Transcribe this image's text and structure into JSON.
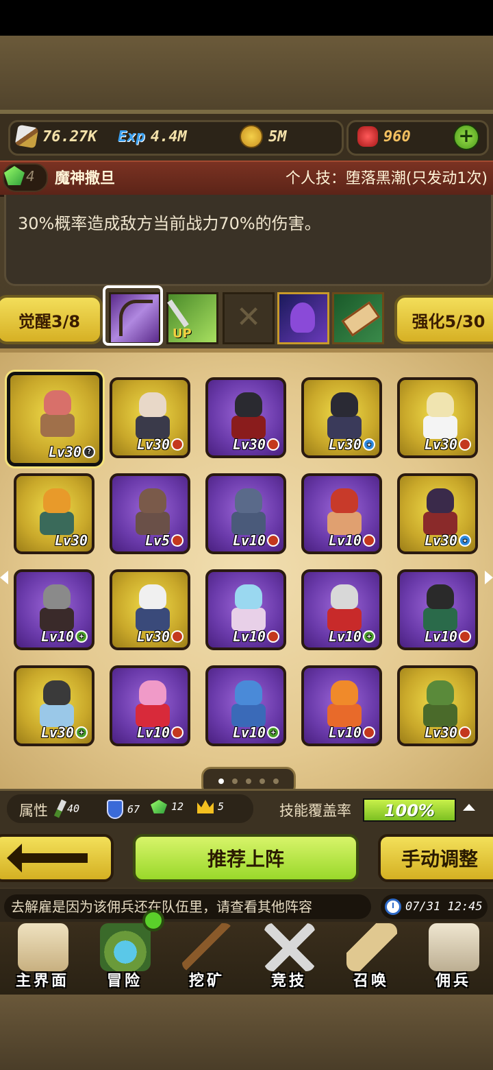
{
  "resources": {
    "attack": "76.27K",
    "exp": "4.4M",
    "gold": "5M",
    "gems": "960"
  },
  "skill": {
    "level": "4",
    "hero_name": "魔神撒旦",
    "personal_skill": "个人技：堕落黑潮(只发动1次)",
    "description": "30%概率造成敌方当前战力70%的伤害。"
  },
  "awaken_label": "觉醒3/8",
  "enhance_label": "强化5/30",
  "heroes": [
    {
      "lv": "Lv30",
      "tier": "gold",
      "badge": "help",
      "badge_glyph": "?",
      "head": "#d8706a",
      "body": "#a0704a"
    },
    {
      "lv": "Lv30",
      "tier": "gold",
      "badge": "red",
      "badge_glyph": "",
      "head": "#e8d8c8",
      "body": "#3a3a4a"
    },
    {
      "lv": "Lv30",
      "tier": "purple",
      "badge": "red",
      "badge_glyph": "",
      "head": "#2a2a30",
      "body": "#8a1c1c"
    },
    {
      "lv": "Lv30",
      "tier": "gold",
      "badge": "blue",
      "badge_glyph": "★",
      "head": "#2a2a34",
      "body": "#3a3a5a"
    },
    {
      "lv": "Lv30",
      "tier": "gold",
      "badge": "red",
      "badge_glyph": "",
      "head": "#f0e4b0",
      "body": "#f4f4f4"
    },
    {
      "lv": "Lv30",
      "tier": "gold",
      "badge": "",
      "badge_glyph": "",
      "head": "#e89a2a",
      "body": "#3a6a5a"
    },
    {
      "lv": "Lv5",
      "tier": "purple",
      "badge": "red",
      "badge_glyph": "",
      "head": "#7a5a4a",
      "body": "#6a5048"
    },
    {
      "lv": "Lv10",
      "tier": "purple",
      "badge": "red",
      "badge_glyph": "",
      "head": "#5a6a8a",
      "body": "#4a5a7a"
    },
    {
      "lv": "Lv10",
      "tier": "purple",
      "badge": "red",
      "badge_glyph": "",
      "head": "#c83a2a",
      "body": "#e0a070"
    },
    {
      "lv": "Lv30",
      "tier": "gold",
      "badge": "blue",
      "badge_glyph": "★",
      "head": "#3a2a4a",
      "body": "#8a2a2a"
    },
    {
      "lv": "Lv10",
      "tier": "purple",
      "badge": "green",
      "badge_glyph": "+",
      "head": "#8a8a8a",
      "body": "#3a2a2a"
    },
    {
      "lv": "Lv30",
      "tier": "gold",
      "badge": "red",
      "badge_glyph": "",
      "head": "#f0f0f0",
      "body": "#3a4a7a"
    },
    {
      "lv": "Lv10",
      "tier": "purple",
      "badge": "red",
      "badge_glyph": "",
      "head": "#9ad8f0",
      "body": "#e8d0e8"
    },
    {
      "lv": "Lv10",
      "tier": "purple",
      "badge": "green",
      "badge_glyph": "+",
      "head": "#d8d8d8",
      "body": "#c82a2a"
    },
    {
      "lv": "Lv10",
      "tier": "purple",
      "badge": "red",
      "badge_glyph": "",
      "head": "#2a2a2a",
      "body": "#2a6a4a"
    },
    {
      "lv": "Lv30",
      "tier": "gold",
      "badge": "green",
      "badge_glyph": "+",
      "head": "#3a3a3a",
      "body": "#9ac8e8"
    },
    {
      "lv": "Lv10",
      "tier": "purple",
      "badge": "red",
      "badge_glyph": "",
      "head": "#f09ac8",
      "body": "#d82a3a"
    },
    {
      "lv": "Lv10",
      "tier": "purple",
      "badge": "green",
      "badge_glyph": "+",
      "head": "#4a8ad8",
      "body": "#3a6ab8"
    },
    {
      "lv": "Lv10",
      "tier": "purple",
      "badge": "red",
      "badge_glyph": "",
      "head": "#f08a2a",
      "body": "#e86a2a"
    },
    {
      "lv": "Lv30",
      "tier": "gold",
      "badge": "red",
      "badge_glyph": "",
      "head": "#5a8a3a",
      "body": "#4a6a2a"
    }
  ],
  "attributes": {
    "label": "属性",
    "agility": "40",
    "defense": "67",
    "gem": "12",
    "crown": "5"
  },
  "coverage": {
    "label": "技能覆盖率",
    "value": "100%",
    "fraction": 1.0
  },
  "actions": {
    "recommend": "推荐上阵",
    "manual": "手动调整"
  },
  "ticker": "去解雇是因为该佣兵还在队伍里，请查看其他阵容",
  "clock": "07/31 12:45",
  "nav": [
    {
      "label": "主界面",
      "icon": "map-scroll-icon"
    },
    {
      "label": "冒险",
      "icon": "island-icon"
    },
    {
      "label": "挖矿",
      "icon": "pickaxe-icon"
    },
    {
      "label": "竞技",
      "icon": "crossed-swords-icon"
    },
    {
      "label": "召唤",
      "icon": "summon-scroll-icon"
    },
    {
      "label": "佣兵",
      "icon": "tent-icon"
    }
  ],
  "colors": {
    "gold_card": "#d8b82a",
    "purple_card": "#6a3aaa",
    "accent_green": "#9ad82a",
    "header_red": "#7a3222"
  }
}
